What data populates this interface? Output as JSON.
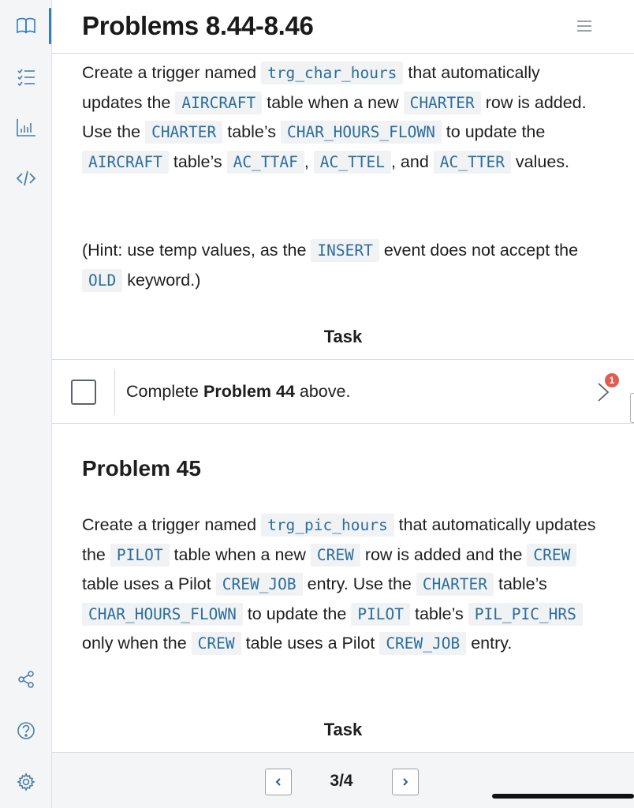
{
  "header": {
    "title": "Problems 8.44-8.46"
  },
  "problem44": {
    "p1_1": "Create a trigger named ",
    "p1_code1": "trg_char_hours",
    "p1_2": " that automatically updates the ",
    "p1_code2": "AIRCRAFT",
    "p1_3": " table when a new ",
    "p1_code3": "CHARTER",
    "p1_4": " row is added. Use the ",
    "p1_code4": "CHARTER",
    "p1_5": " table’s ",
    "p1_code5": "CHAR_HOURS_FLOWN",
    "p1_6": " to update the ",
    "p1_code6": "AIRCRAFT",
    "p1_7": " table’s ",
    "p1_code7": "AC_TTAF",
    "p1_8": ", ",
    "p1_code8": "AC_TTEL",
    "p1_9": ", and ",
    "p1_code9": "AC_TTER",
    "p1_10": " values.",
    "hint_1": "(Hint: use temp values, as the ",
    "hint_code1": "INSERT",
    "hint_2": " event does not accept the ",
    "hint_code2": "OLD",
    "hint_3": " keyword.)",
    "task_label": "Task",
    "task_text_1": "Complete ",
    "task_text_bold": "Problem 44",
    "task_text_2": " above.",
    "badge_count": "1"
  },
  "problem45": {
    "title": "Problem 45",
    "p_1": "Create a trigger named ",
    "p_code1": "trg_pic_hours",
    "p_2": " that automatically updates the ",
    "p_code2": "PILOT",
    "p_3": " table when a new ",
    "p_code3": "CREW",
    "p_4": " row is added and the ",
    "p_code4": "CREW",
    "p_5": " table uses a Pilot ",
    "p_code5": "CREW_JOB",
    "p_6": " entry. Use the ",
    "p_code6": "CHARTER",
    "p_7": " table’s ",
    "p_code7": "CHAR_HOURS_FLOWN",
    "p_8": " to update the ",
    "p_code8": "PILOT",
    "p_9": " table’s ",
    "p_code9": "PIL_PIC_HRS",
    "p_10": " only when the ",
    "p_code10": "CREW",
    "p_11": " table uses a Pilot ",
    "p_code11": "CREW_JOB",
    "p_12": " entry.",
    "task_label": "Task"
  },
  "footer": {
    "page_indicator": "3/4"
  },
  "sidebar": {
    "icons": [
      "book-icon",
      "checklist-icon",
      "bar-chart-icon",
      "code-icon",
      "share-icon",
      "help-icon",
      "settings-icon"
    ]
  },
  "colors": {
    "accent": "#2d7fc6",
    "code_text": "#2c6e9c",
    "code_bg": "#f0f2f4",
    "badge": "#e05c4f"
  }
}
